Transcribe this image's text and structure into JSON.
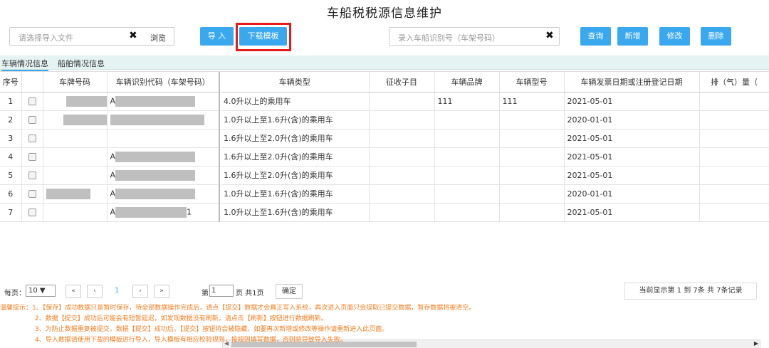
{
  "page_title": "车船税税源信息维护",
  "file_select": {
    "placeholder": "请选择导入文件",
    "clear": "✖",
    "browse": "浏览"
  },
  "buttons": {
    "import": "导 入",
    "download_template": "下载模板",
    "query": "查询",
    "add": "新增",
    "edit": "修改",
    "delete": "删除"
  },
  "vin_search": {
    "placeholder": "录入车船识别号（车架号码）",
    "clear": "✖"
  },
  "tabs": [
    "车辆情况信息",
    "船舶情况信息"
  ],
  "columns": {
    "left": [
      "序号",
      "",
      "车牌号码",
      "车辆识别代码（车架号码）"
    ],
    "right": [
      "车辆类型",
      "征收子目",
      "车辆品牌",
      "车辆型号",
      "车辆发票日期或注册登记日期",
      "排（气）量（"
    ]
  },
  "rows": [
    {
      "no": "1",
      "vin_prefix": "A",
      "vin_suffix": "",
      "type": "4.0升以上的乘用车",
      "sub": "",
      "brand": "111",
      "model": "111",
      "date": "2021-05-01"
    },
    {
      "no": "2",
      "vin_prefix": "",
      "vin_suffix": "",
      "type": "1.0升以上至1.6升(含)的乘用车",
      "sub": "",
      "brand": "",
      "model": "",
      "date": "2020-01-01"
    },
    {
      "no": "3",
      "vin_prefix": "",
      "vin_suffix": "",
      "type": "1.6升以上至2.0升(含)的乘用车",
      "sub": "",
      "brand": "",
      "model": "",
      "date": "2021-05-01"
    },
    {
      "no": "4",
      "vin_prefix": "A",
      "vin_suffix": "",
      "type": "1.6升以上至2.0升(含)的乘用车",
      "sub": "",
      "brand": "",
      "model": "",
      "date": "2021-05-01"
    },
    {
      "no": "5",
      "vin_prefix": "A",
      "vin_suffix": "",
      "type": "1.6升以上至2.0升(含)的乘用车",
      "sub": "",
      "brand": "",
      "model": "",
      "date": "2021-05-01"
    },
    {
      "no": "6",
      "vin_prefix": "A",
      "vin_suffix": "",
      "type": "1.0升以上至1.6升(含)的乘用车",
      "sub": "",
      "brand": "",
      "model": "",
      "date": "2020-01-01"
    },
    {
      "no": "7",
      "vin_prefix": "A",
      "vin_suffix": "1",
      "type": "1.0升以上至1.6升(含)的乘用车",
      "sub": "",
      "brand": "",
      "model": "",
      "date": "2021-05-01"
    }
  ],
  "pager": {
    "per_page_label": "每页：",
    "per_page_value": "10 ▼",
    "first": "«",
    "prev": "‹",
    "current": "1",
    "next": "›",
    "last": "»",
    "page_prefix": "第",
    "page_input": "1",
    "page_total": "页 共1页",
    "confirm": "确定",
    "info": "当前显示第 1 到 7条 共 7条记录"
  },
  "tips": [
    "温馨提示：1、【保存】成功数据只是暂时保存，待全部数据操作完成后，请点【提交】数据才会真正写入系统，再次进入页面只会提取已提交数据，暂存数据将被清空。",
    "2、数据【提交】成功后可能会有短暂延迟，如发现数据没有刷新，请点击【刷新】按钮进行数据刷新。",
    "3、为防止数据重复被提交，数据【提交】成功后，【提交】按钮将会被隐藏，如要再次新增或修改等操作请重新进入此页面。",
    "4、导入数据请使用下载的模板进行导入，导入模板有相应校验规则，按规则填写数据，否则将导致导入失败。"
  ],
  "colors": {
    "accent": "#3aa8ee",
    "highlight": "#e51a1a",
    "tip": "#f47c1e",
    "tab_bg": "#e6f3f3"
  }
}
